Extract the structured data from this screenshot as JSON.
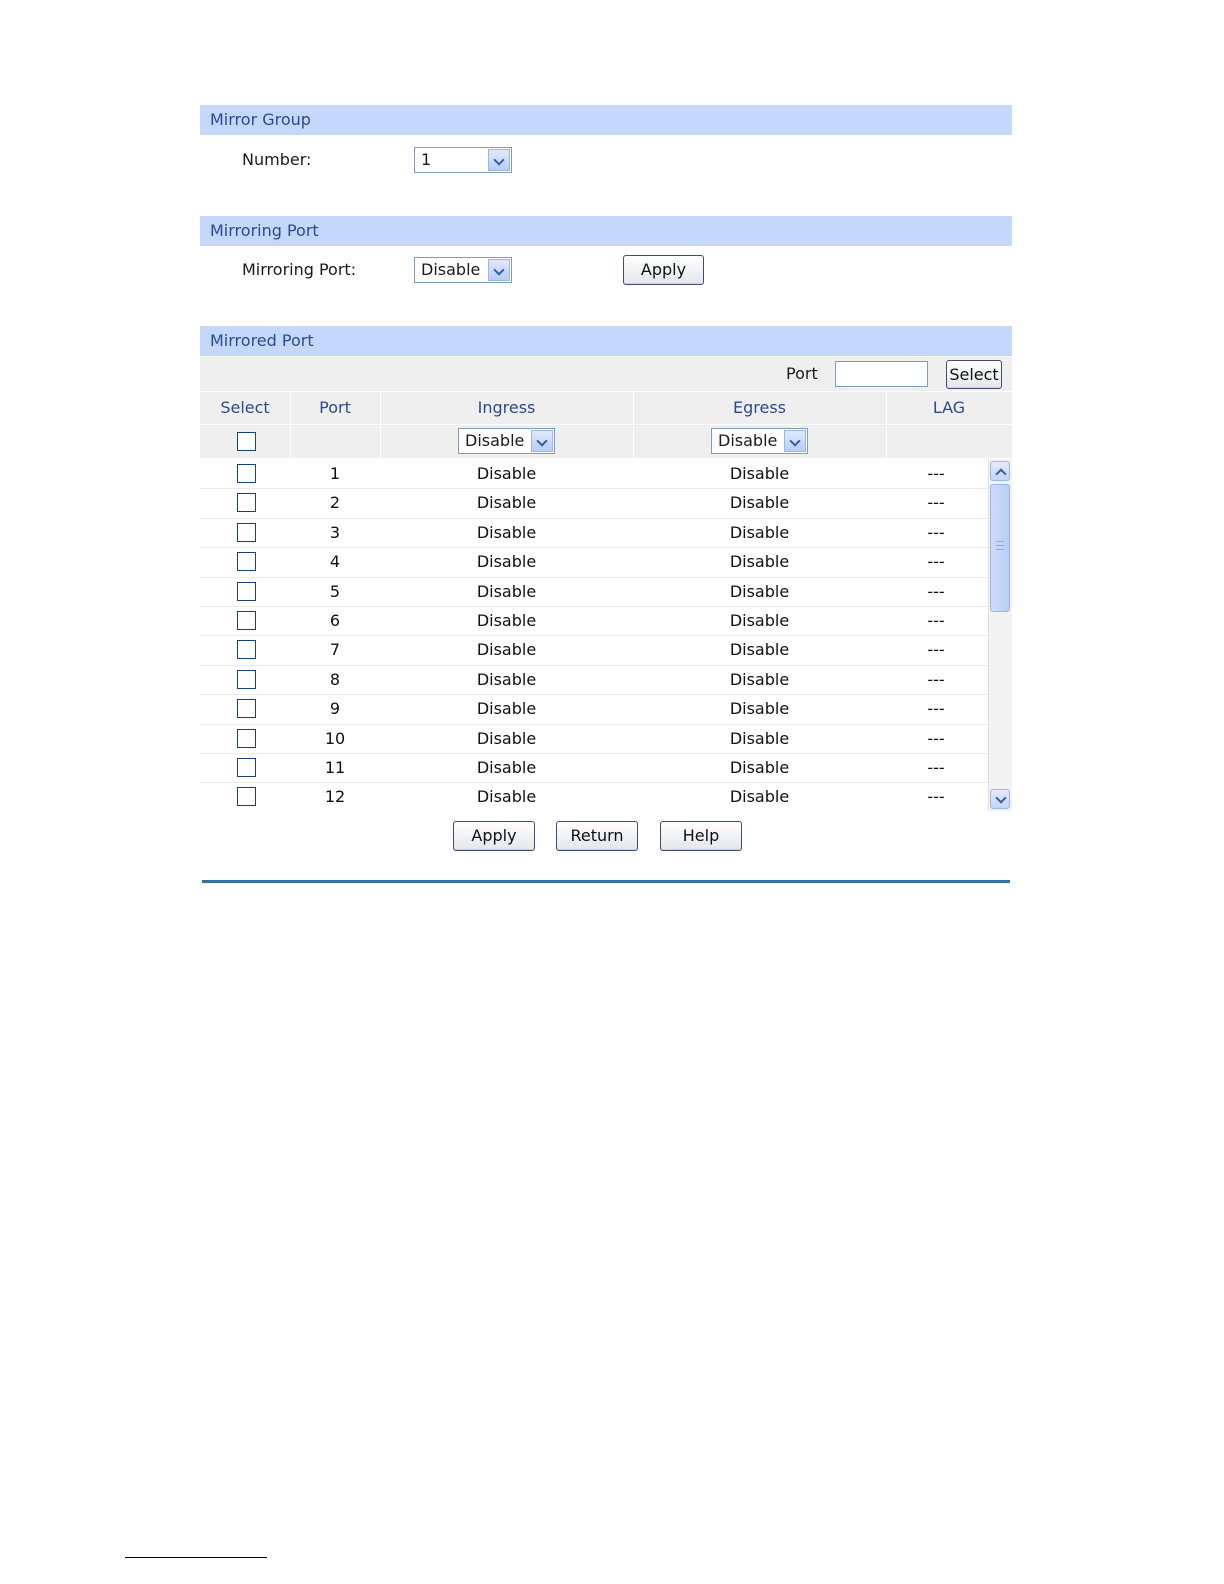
{
  "mirror_group": {
    "title": "Mirror Group",
    "number_label": "Number:",
    "number_value": "1"
  },
  "mirroring_port": {
    "title": "Mirroring Port",
    "port_label": "Mirroring Port:",
    "port_value": "Disable",
    "apply_label": "Apply"
  },
  "mirrored_port": {
    "title": "Mirrored Port",
    "filter_label": "Port",
    "filter_value": "",
    "select_button_label": "Select",
    "columns": [
      "Select",
      "Port",
      "Ingress",
      "Egress",
      "LAG"
    ],
    "all_ingress_value": "Disable",
    "all_egress_value": "Disable",
    "rows": [
      {
        "port": "1",
        "ingress": "Disable",
        "egress": "Disable",
        "lag": "---"
      },
      {
        "port": "2",
        "ingress": "Disable",
        "egress": "Disable",
        "lag": "---"
      },
      {
        "port": "3",
        "ingress": "Disable",
        "egress": "Disable",
        "lag": "---"
      },
      {
        "port": "4",
        "ingress": "Disable",
        "egress": "Disable",
        "lag": "---"
      },
      {
        "port": "5",
        "ingress": "Disable",
        "egress": "Disable",
        "lag": "---"
      },
      {
        "port": "6",
        "ingress": "Disable",
        "egress": "Disable",
        "lag": "---"
      },
      {
        "port": "7",
        "ingress": "Disable",
        "egress": "Disable",
        "lag": "---"
      },
      {
        "port": "8",
        "ingress": "Disable",
        "egress": "Disable",
        "lag": "---"
      },
      {
        "port": "9",
        "ingress": "Disable",
        "egress": "Disable",
        "lag": "---"
      },
      {
        "port": "10",
        "ingress": "Disable",
        "egress": "Disable",
        "lag": "---"
      },
      {
        "port": "11",
        "ingress": "Disable",
        "egress": "Disable",
        "lag": "---"
      },
      {
        "port": "12",
        "ingress": "Disable",
        "egress": "Disable",
        "lag": "---"
      }
    ]
  },
  "footer": {
    "apply_label": "Apply",
    "return_label": "Return",
    "help_label": "Help"
  },
  "colors": {
    "section_header_bg": "#c5d7fb",
    "section_header_text": "#2c4a8c",
    "divider": "#3a6f9a"
  }
}
